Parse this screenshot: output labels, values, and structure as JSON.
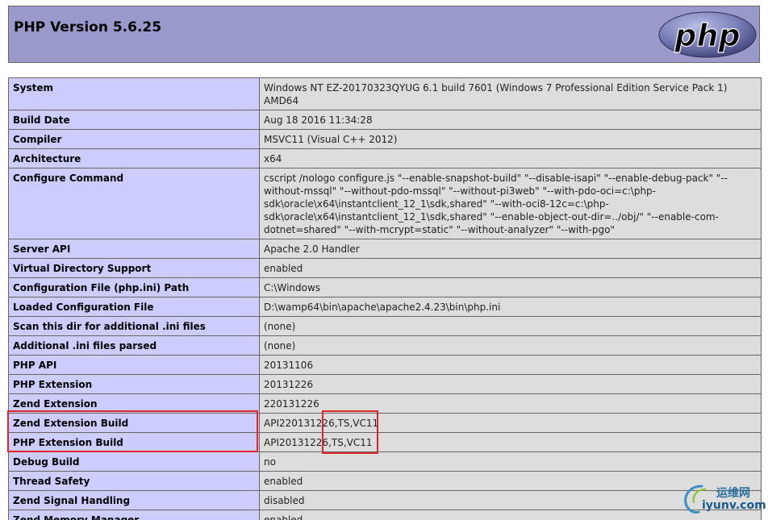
{
  "header": {
    "title": "PHP Version 5.6.25",
    "logo_text": "php"
  },
  "rows": [
    {
      "label": "System",
      "value": "Windows NT EZ-20170323QYUG 6.1 build 7601 (Windows 7 Professional Edition Service Pack 1) AMD64"
    },
    {
      "label": "Build Date",
      "value": "Aug 18 2016 11:34:28"
    },
    {
      "label": "Compiler",
      "value": "MSVC11 (Visual C++ 2012)"
    },
    {
      "label": "Architecture",
      "value": "x64"
    },
    {
      "label": "Configure Command",
      "value": "cscript /nologo configure.js \"--enable-snapshot-build\" \"--disable-isapi\" \"--enable-debug-pack\" \"--without-mssql\" \"--without-pdo-mssql\" \"--without-pi3web\" \"--with-pdo-oci=c:\\php-sdk\\oracle\\x64\\instantclient_12_1\\sdk,shared\" \"--with-oci8-12c=c:\\php-sdk\\oracle\\x64\\instantclient_12_1\\sdk,shared\" \"--enable-object-out-dir=../obj/\" \"--enable-com-dotnet=shared\" \"--with-mcrypt=static\" \"--without-analyzer\" \"--with-pgo\""
    },
    {
      "label": "Server API",
      "value": "Apache 2.0 Handler"
    },
    {
      "label": "Virtual Directory Support",
      "value": "enabled"
    },
    {
      "label": "Configuration File (php.ini) Path",
      "value": "C:\\Windows"
    },
    {
      "label": "Loaded Configuration File",
      "value": "D:\\wamp64\\bin\\apache\\apache2.4.23\\bin\\php.ini"
    },
    {
      "label": "Scan this dir for additional .ini files",
      "value": "(none)"
    },
    {
      "label": "Additional .ini files parsed",
      "value": "(none)"
    },
    {
      "label": "PHP API",
      "value": "20131106"
    },
    {
      "label": "PHP Extension",
      "value": "20131226"
    },
    {
      "label": "Zend Extension",
      "value": "220131226"
    },
    {
      "label": "Zend Extension Build",
      "value": "API220131226,TS,VC11"
    },
    {
      "label": "PHP Extension Build",
      "value": "API20131226,TS,VC11"
    },
    {
      "label": "Debug Build",
      "value": "no"
    },
    {
      "label": "Thread Safety",
      "value": "enabled"
    },
    {
      "label": "Zend Signal Handling",
      "value": "disabled"
    },
    {
      "label": "Zend Memory Manager",
      "value": "enabled"
    }
  ],
  "watermark": {
    "cn_text": "运维网",
    "url_text": "iyunv.com"
  },
  "colors": {
    "header_bg": "#9999cc",
    "label_bg": "#ccccff",
    "value_bg": "#dddddd",
    "highlight": "#e0262b"
  }
}
